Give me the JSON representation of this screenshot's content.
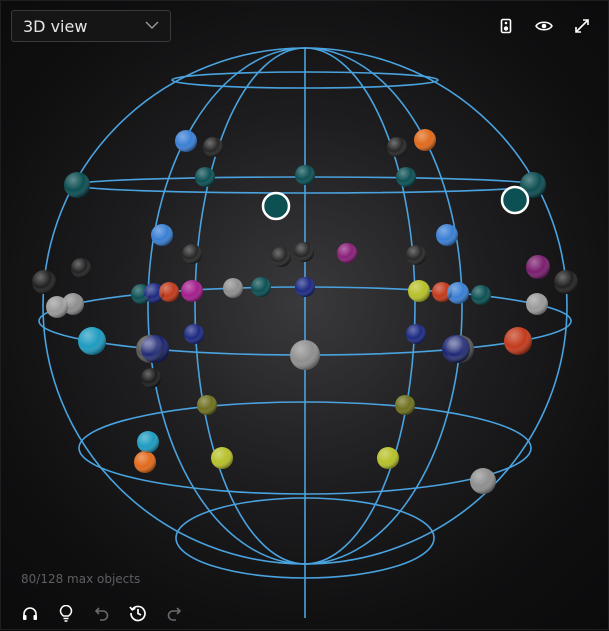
{
  "view_selector": {
    "value": "3D view",
    "icon": "chevron-down-icon"
  },
  "toolbar": {
    "icons": [
      "speaker-icon",
      "eye-icon",
      "expand-icon"
    ]
  },
  "status": {
    "object_count": "80/128 max objects"
  },
  "bottom_toolbar": {
    "icons": [
      "headphones-icon",
      "lightbulb-icon",
      "undo-icon",
      "history-icon",
      "redo-icon"
    ]
  },
  "colors": {
    "grid": "#4aa3df",
    "selection_ring": "#ffffff"
  }
}
